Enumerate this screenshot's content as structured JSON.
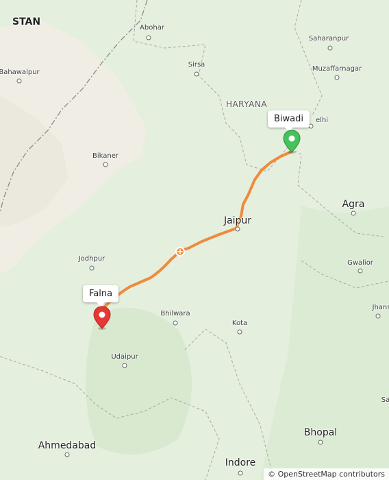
{
  "map": {
    "labels": {
      "stan": "STAN",
      "abohar": "Abohar",
      "saharanpur": "Saharanpur",
      "bahawalpur": "Bahawalpur",
      "sirsa": "Sirsa",
      "muzaffarnagar": "Muzaffarnagar",
      "haryana": "HARYANA",
      "delhi": "elhi",
      "bikaner": "Bikaner",
      "agra": "Agra",
      "jaipur": "Jaipur",
      "jodhpur": "Jodhpur",
      "gwalior": "Gwalior",
      "bhilwara": "Bhilwara",
      "jhansi": "Jhans",
      "kota": "Kota",
      "udaipur": "Udaipur",
      "sa": "Sa",
      "ahmedabad": "Ahmedabad",
      "bhopal": "Bhopal",
      "indore": "Indore"
    },
    "route": {
      "color": "#f08a3c",
      "origin_label": "Falna",
      "destination_label": "Biwadi",
      "origin_pin_color": "#e53935",
      "destination_pin_color": "#43c35a"
    },
    "colors": {
      "land": "#e4efdd",
      "desert": "#efede4",
      "border": "#9e9e9e"
    },
    "attribution": "© OpenStreetMap contributors"
  }
}
